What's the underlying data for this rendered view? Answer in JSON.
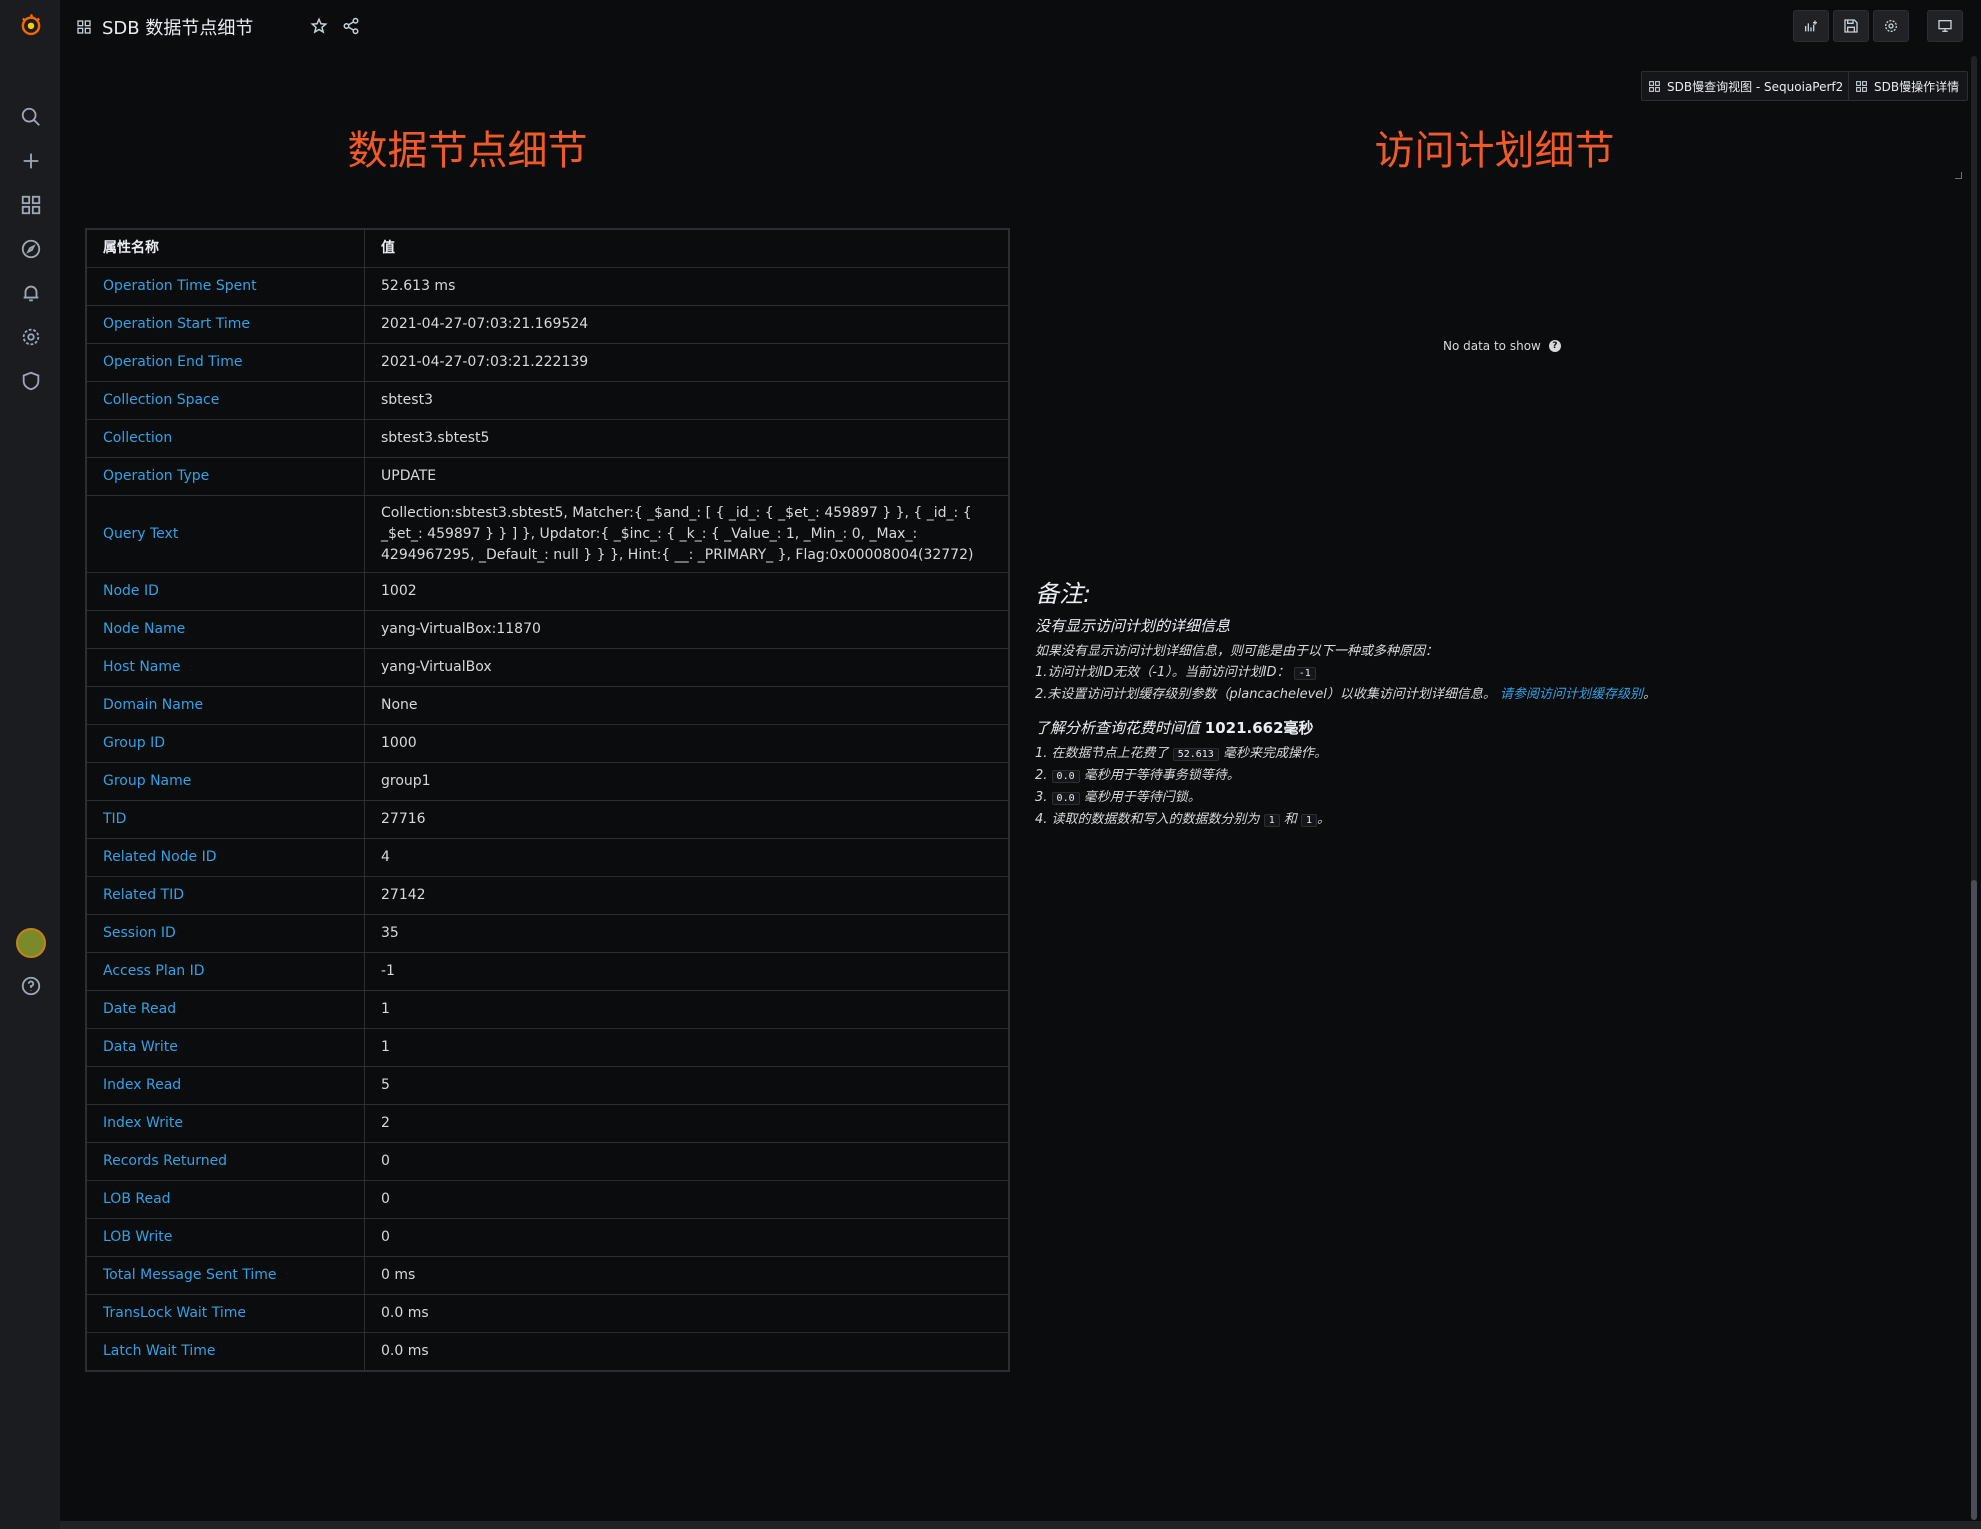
{
  "dashboard": {
    "title": "SDB 数据节点细节"
  },
  "links": [
    {
      "label": "SDB慢查询视图 - SequoiaPerf2"
    },
    {
      "label": "SDB慢操作详情"
    }
  ],
  "panels": {
    "left_heading": "数据节点细节",
    "right_heading": "访问计划细节"
  },
  "table": {
    "headers": [
      "属性名称",
      "值"
    ],
    "rows": [
      {
        "k": "Operation Time Spent",
        "v": "52.613 ms"
      },
      {
        "k": "Operation Start Time",
        "v": "2021-04-27-07:03:21.169524"
      },
      {
        "k": "Operation End Time",
        "v": "2021-04-27-07:03:21.222139"
      },
      {
        "k": "Collection Space",
        "v": "sbtest3"
      },
      {
        "k": "Collection",
        "v": "sbtest3.sbtest5"
      },
      {
        "k": "Operation Type",
        "v": "UPDATE"
      },
      {
        "k": "Query Text",
        "v": "Collection:sbtest3.sbtest5, Matcher:{ _$and_: [ { _id_: { _$et_: 459897 } }, { _id_: { _$et_: 459897 } } ] }, Updator:{ _$inc_: { _k_: { _Value_: 1, _Min_: 0, _Max_: 4294967295, _Default_: null } } }, Hint:{ __: _PRIMARY_ }, Flag:0x00008004(32772)"
      },
      {
        "k": "Node ID",
        "v": "1002"
      },
      {
        "k": "Node Name",
        "v": "yang-VirtualBox:11870"
      },
      {
        "k": "Host Name",
        "v": "yang-VirtualBox"
      },
      {
        "k": "Domain Name",
        "v": "None"
      },
      {
        "k": "Group ID",
        "v": "1000"
      },
      {
        "k": "Group Name",
        "v": "group1"
      },
      {
        "k": "TID",
        "v": "27716"
      },
      {
        "k": "Related Node ID",
        "v": "4"
      },
      {
        "k": "Related TID",
        "v": "27142"
      },
      {
        "k": "Session ID",
        "v": "35"
      },
      {
        "k": "Access Plan ID",
        "v": "-1"
      },
      {
        "k": "Date Read",
        "v": "1"
      },
      {
        "k": "Data Write",
        "v": "1"
      },
      {
        "k": "Index Read",
        "v": "5"
      },
      {
        "k": "Index Write",
        "v": "2"
      },
      {
        "k": "Records Returned",
        "v": "0"
      },
      {
        "k": "LOB Read",
        "v": "0"
      },
      {
        "k": "LOB Write",
        "v": "0"
      },
      {
        "k": "Total Message Sent Time",
        "v": "0 ms"
      },
      {
        "k": "TransLock Wait Time",
        "v": "0.0 ms"
      },
      {
        "k": "Latch Wait Time",
        "v": "0.0 ms"
      }
    ]
  },
  "right_panel": {
    "no_data": "No data to show"
  },
  "notes": {
    "title": "备注:",
    "subtitle": "没有显示访问计划的详细信息",
    "intro": "如果没有显示访问计划详细信息，则可能是由于以下一种或多种原因：",
    "reason1_prefix": "1.访问计划ID无效（-1）。当前访问计划ID：",
    "reason1_code": "-1",
    "reason2_prefix": "2.未设置访问计划缓存级别参数（plancachelevel）以收集访问计划详细信息。",
    "reason2_link": "请参阅访问计划缓存级别",
    "reason2_suffix": "。",
    "section_prefix": "了解分析查询花费时间值",
    "section_value": "1021.662毫秒",
    "item1_prefix": "1. 在数据节点上花费了",
    "item1_code": "52.613",
    "item1_suffix": "毫秒来完成操作。",
    "item2_prefix": "2.",
    "item2_code": "0.0",
    "item2_suffix": "毫秒用于等待事务锁等待。",
    "item3_prefix": "3.",
    "item3_code": "0.0",
    "item3_suffix": "毫秒用于等待闩锁。",
    "item4_prefix": "4. 读取的数据数和写入的数据数分别为",
    "item4_code1": "1",
    "item4_mid": "和",
    "item4_code2": "1",
    "item4_suffix": "。"
  }
}
